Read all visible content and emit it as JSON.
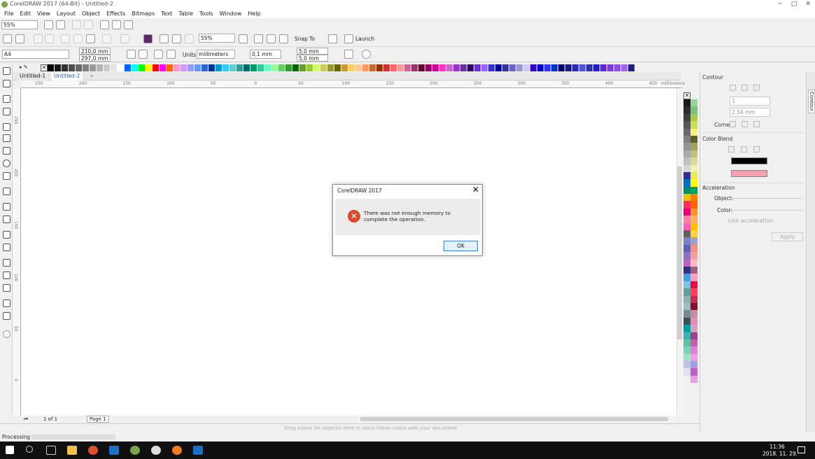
{
  "window": {
    "title": "CorelDRAW 2017 (64-Bit) - Untitled-2",
    "min": "─",
    "max": "□",
    "close": "✕"
  },
  "menu": [
    "File",
    "Edit",
    "View",
    "Layout",
    "Object",
    "Effects",
    "Bitmaps",
    "Text",
    "Table",
    "Tools",
    "Window",
    "Help"
  ],
  "toolbar": {
    "zoom_left": "55%",
    "zoom_main": "55%",
    "snap_to": "Snap To",
    "launch": "Launch"
  },
  "propbar": {
    "page_size": "A4",
    "width": "210,0 mm",
    "height": "297,0 mm",
    "units_label": "Units:",
    "units": "millimeters",
    "nudge": "0,1 mm",
    "dup_x": "5,0 mm",
    "dup_y": "5,0 mm"
  },
  "tabs": [
    "Untitled-1",
    "Untitled-2"
  ],
  "ruler": {
    "labels": [
      "250",
      "200",
      "150",
      "100",
      "50",
      "0",
      "50",
      "100",
      "150",
      "200",
      "250",
      "300",
      "350",
      "400",
      "450"
    ],
    "unit": "millimeters"
  },
  "vruler": {
    "labels": [
      "250",
      "200",
      "150",
      "100",
      "50",
      "0"
    ]
  },
  "palette": {
    "top": [
      "#000000",
      "#1a1a1a",
      "#333333",
      "#4d4d4d",
      "#666666",
      "#808080",
      "#999999",
      "#b3b3b3",
      "#cccccc",
      "#e6e6e6",
      "#ffffff",
      "#0066ff",
      "#00ffff",
      "#00ff00",
      "#ffff00",
      "#ff0000",
      "#ff00ff",
      "#ff6600",
      "#ff99cc",
      "#cc99ff",
      "#9999ff",
      "#6699ff",
      "#3366cc",
      "#003399",
      "#0099cc",
      "#33ccff",
      "#66cccc",
      "#339999",
      "#006666",
      "#009966",
      "#33cc99",
      "#66ffcc",
      "#99ff99",
      "#66cc66",
      "#339933",
      "#006600",
      "#669933",
      "#99cc33",
      "#ccff66",
      "#cccc66",
      "#999933",
      "#666600",
      "#cc9933",
      "#ffcc66",
      "#ffcc99",
      "#ff9966",
      "#cc6633",
      "#993300",
      "#cc3333",
      "#ff6666",
      "#ff9999",
      "#cc6699",
      "#993366",
      "#660033",
      "#990066",
      "#cc0099",
      "#ff33cc",
      "#cc66cc",
      "#9933cc",
      "#663399",
      "#330066",
      "#6633cc",
      "#9966ff",
      "#3333cc",
      "#000099",
      "#333399",
      "#6666cc",
      "#9999cc",
      "#ccccff",
      "#3300cc",
      "#0000cc",
      "#3333ff",
      "#0033cc",
      "#000066",
      "#1c1c80",
      "#2b2bb0",
      "#5050e0",
      "#3030a0",
      "#2020c0",
      "#5d2dc9",
      "#7a3fd9",
      "#8c50e6",
      "#a066f0",
      "#202080"
    ],
    "side": [
      "#1a1a1a",
      "#9bd39b",
      "#2d2d2d",
      "#7dbf7d",
      "#404040",
      "#a8c850",
      "#555555",
      "#c8e050",
      "#6a6a6a",
      "#f0f080",
      "#808080",
      "#606030",
      "#959595",
      "#a0a060",
      "#aaaaaa",
      "#c0c080",
      "#c0c0c0",
      "#d8d8a0",
      "#d5d5d5",
      "#f0f0b0",
      "#30308a",
      "#e8e860",
      "#0070c0",
      "#ffff00",
      "#009060",
      "#00a060",
      "#f0c000",
      "#ff8000",
      "#ff3060",
      "#ff6000",
      "#e00080",
      "#ff9030",
      "#ff80a0",
      "#ffb060",
      "#ff60c0",
      "#ffc000",
      "#606060",
      "#ffd040",
      "#8080c0",
      "#a0a0d0",
      "#6060b0",
      "#f09080",
      "#9070c0",
      "#f0a0a0",
      "#c060c0",
      "#ffc0c0",
      "#303080",
      "#a06080",
      "#40a0e0",
      "#ffa0c0",
      "#80c0e0",
      "#e01040",
      "#60a0a0",
      "#ff4060",
      "#90b0b0",
      "#c03050",
      "#a0c0c0",
      "#7f1030",
      "#808890",
      "#c090a0",
      "#405060",
      "#e090b0",
      "#00a0a0",
      "#d0a0c0",
      "#40b0b0",
      "#a04090",
      "#60c0a0",
      "#c060b0",
      "#80d0c0",
      "#e080d0",
      "#a0e0d0",
      "#f0a0e0",
      "#c0c0e0",
      "#a0a0e0",
      "#e0e0f0",
      "#c060c0",
      "#f0f0f0",
      "#e0a0e0"
    ]
  },
  "docker": {
    "title": "Contour",
    "side_tab": "Contour",
    "steps": "1",
    "offset": "2,54 mm",
    "corner": "Corner:",
    "color_blend": "Color Blend",
    "outline_color": "#000000",
    "fill_color": "#f4a0b0",
    "acceleration": "Acceleration",
    "object": "Object:",
    "color": "Color:",
    "link": "Link acceleration",
    "apply": "Apply"
  },
  "pagebar": {
    "page_of": "1 of 1",
    "page_tab": "Page 1"
  },
  "status": {
    "drag_hint": "Drag colors (or objects) here to store these colors with your document",
    "processing": "Processing"
  },
  "dialog": {
    "title": "CorelDRAW 2017",
    "close": "✕",
    "message": "There was not enough memory to complete the operation.",
    "ok": "OK",
    "error_icon": "✕"
  },
  "taskbar": {
    "time": "11:36",
    "date": "2018. 11. 29.",
    "icons": [
      "windows-icon",
      "search-icon",
      "taskview-icon",
      "file-explorer-icon",
      "app-icon",
      "outlook-icon",
      "coreldraw-icon",
      "cloud-icon",
      "firefox-icon",
      "outlook2-icon"
    ]
  }
}
